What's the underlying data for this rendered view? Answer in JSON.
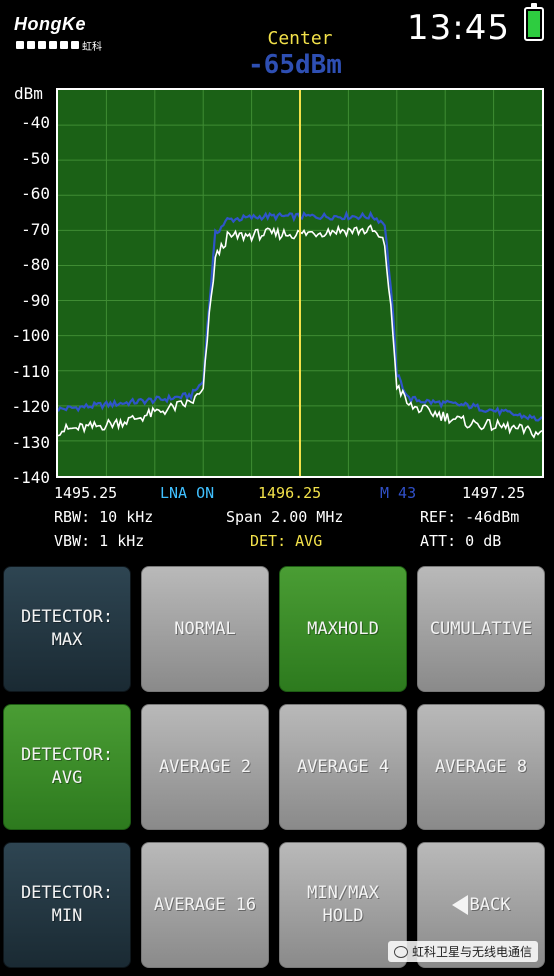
{
  "header": {
    "brand_name": "HongKe",
    "brand_cn": "虹科",
    "time": "13:45",
    "battery_icon": "battery-full-icon"
  },
  "center": {
    "label": "Center",
    "value": "-65dBm"
  },
  "chart_data": {
    "type": "line",
    "ylabel": "dBm",
    "yticks": [
      "-40",
      "-50",
      "-60",
      "-70",
      "-80",
      "-90",
      "-100",
      "-110",
      "-120",
      "-130",
      "-140"
    ],
    "ylim": [
      -140,
      -30
    ],
    "xlim": [
      1495.25,
      1497.25
    ],
    "center_marker_mhz": 1496.25,
    "grid": true,
    "series": [
      {
        "color": "#2f55c8",
        "x": [
          1495.25,
          1495.4,
          1495.55,
          1495.7,
          1495.8,
          1495.85,
          1495.87,
          1495.9,
          1495.95,
          1496.1,
          1496.25,
          1496.4,
          1496.55,
          1496.6,
          1496.63,
          1496.65,
          1496.7,
          1496.8,
          1496.95,
          1497.1,
          1497.25
        ],
        "y": [
          -121,
          -120,
          -119,
          -118,
          -117,
          -113,
          -95,
          -71,
          -67,
          -66,
          -66,
          -66,
          -66,
          -68,
          -90,
          -111,
          -118,
          -119,
          -120,
          -122,
          -124
        ]
      },
      {
        "color": "#ffffff",
        "x": [
          1495.25,
          1495.4,
          1495.55,
          1495.7,
          1495.8,
          1495.85,
          1495.87,
          1495.9,
          1495.95,
          1496.1,
          1496.25,
          1496.4,
          1496.55,
          1496.6,
          1496.63,
          1496.65,
          1496.7,
          1496.8,
          1496.95,
          1497.1,
          1497.25
        ],
        "y": [
          -127,
          -126,
          -124,
          -121,
          -119,
          -116,
          -98,
          -78,
          -72,
          -71,
          -71,
          -70,
          -70,
          -74,
          -96,
          -114,
          -120,
          -122,
          -125,
          -126,
          -128
        ]
      }
    ]
  },
  "info": {
    "start_freq": "1495.25",
    "lna": "LNA ON",
    "center_freq": "1496.25",
    "marker": "M 43",
    "stop_freq": "1497.25",
    "rbw": "RBW: 10 kHz",
    "span": "Span 2.00 MHz",
    "ref": "REF: -46dBm",
    "vbw": "VBW: 1 kHz",
    "det": "DET: AVG",
    "att": "ATT:  0 dB"
  },
  "buttons": {
    "detector_max": "DETECTOR:\nMAX",
    "normal": "NORMAL",
    "maxhold": "MAXHOLD",
    "cumulative": "CUMULATIVE",
    "detector_avg": "DETECTOR:\nAVG",
    "average2": "AVERAGE 2",
    "average4": "AVERAGE 4",
    "average8": "AVERAGE 8",
    "detector_min": "DETECTOR:\nMIN",
    "average16": "AVERAGE 16",
    "minmax_hold": "MIN/MAX\nHOLD",
    "back": "BACK"
  },
  "watermark": {
    "text": "虹科卫星与无线电通信"
  }
}
